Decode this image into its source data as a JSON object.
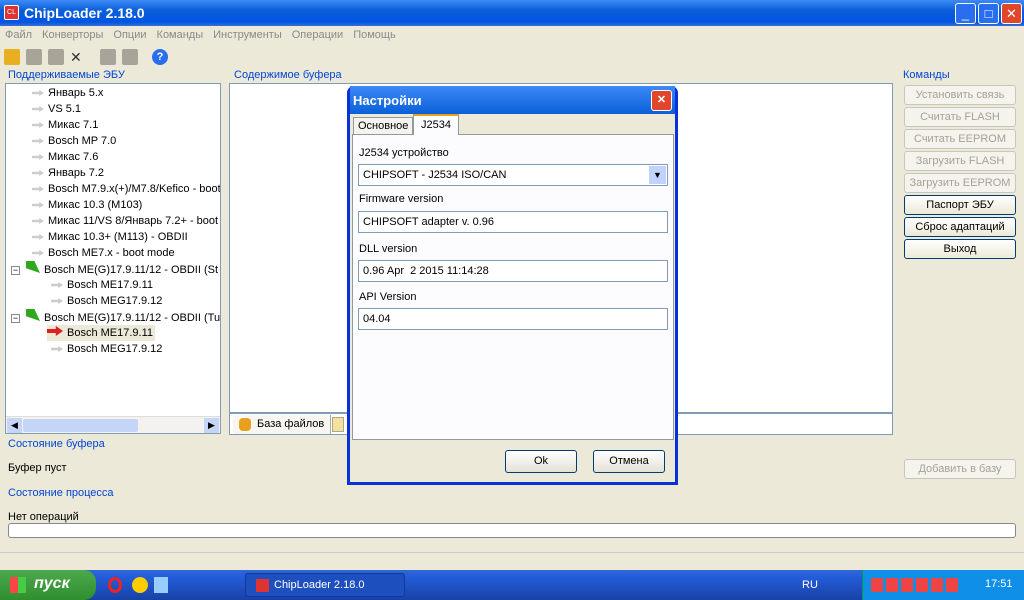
{
  "window": {
    "title": "ChipLoader 2.18.0",
    "app_icon": "CL"
  },
  "menu": [
    "Файл",
    "Конверторы",
    "Опции",
    "Команды",
    "Инструменты",
    "Операции",
    "Помощь"
  ],
  "left_panel": {
    "title": "Поддерживаемые ЭБУ",
    "items": [
      "Январь 5.x",
      "VS 5.1",
      "Микас 7.1",
      "Bosch MP 7.0",
      "Микас 7.6",
      "Январь 7.2",
      "Bosch M7.9.x(+)/M7.8/Kefico - boot",
      "Микас 10.3 (M103)",
      "Микас 11/VS 8/Январь 7.2+ - boot",
      "Микас 10.3+ (M113) - OBDII",
      "Bosch ME7.x - boot mode"
    ],
    "group1": {
      "label": "Bosch ME(G)17.9.11/12 - OBDII (St",
      "children": [
        "Bosch ME17.9.11",
        "Bosch MEG17.9.12"
      ]
    },
    "group2": {
      "label": "Bosch ME(G)17.9.11/12 - OBDII (Tu",
      "children": [
        "Bosch ME17.9.11",
        "Bosch MEG17.9.12"
      ]
    }
  },
  "buffer": {
    "title": "Содержимое буфера",
    "tab": "База файлов"
  },
  "commands": {
    "title": "Команды",
    "buttons": [
      "Установить связь",
      "Считать FLASH",
      "Считать EEPROM",
      "Загрузить FLASH",
      "Загрузить EEPROM",
      "Паспорт ЭБУ",
      "Сброс адаптаций",
      "Выход"
    ]
  },
  "buffer_state": {
    "title": "Состояние буфера",
    "text": "Буфер пуст",
    "add_button": "Добавить в базу"
  },
  "process_state": {
    "title": "Состояние процесса",
    "text": "Нет операций",
    "progress": 0
  },
  "dialog": {
    "title": "Настройки",
    "tabs": [
      "Основное",
      "J2534"
    ],
    "device_label": "J2534 устройство",
    "device_value": "CHIPSOFT - J2534 ISO/CAN",
    "firmware_label": "Firmware version",
    "firmware_value": "CHIPSOFT adapter v. 0.96",
    "dll_label": "DLL version",
    "dll_value": "0.96 Apr  2 2015 11:14:28",
    "api_label": "API Version",
    "api_value": "04.04",
    "ok": "Ok",
    "cancel": "Отмена"
  },
  "taskbar": {
    "start": "пуск",
    "task": "ChipLoader 2.18.0",
    "lang": "RU",
    "clock": "17:51"
  }
}
